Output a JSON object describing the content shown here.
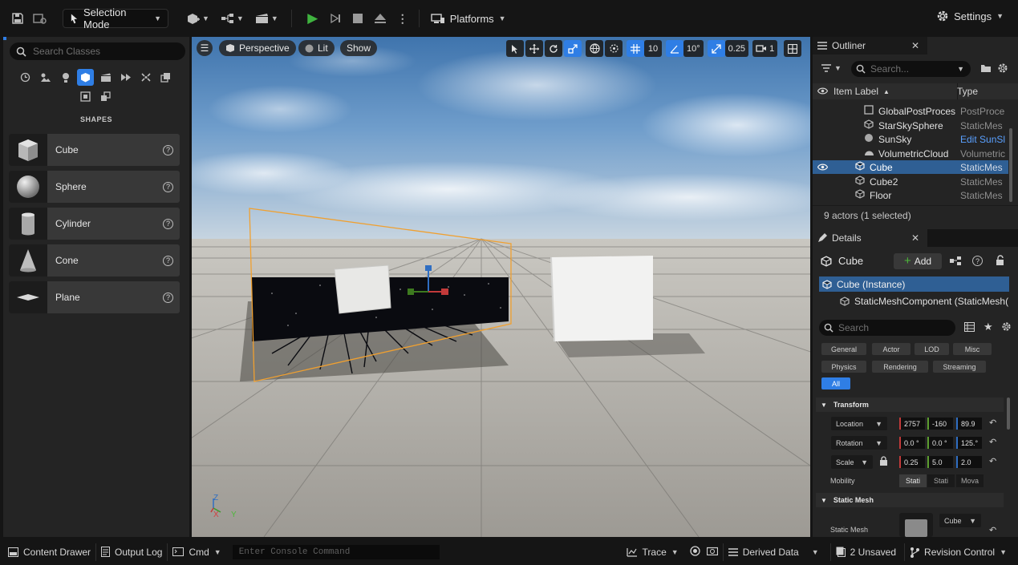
{
  "toolbar": {
    "mode_label": "Selection Mode",
    "platforms_label": "Platforms",
    "settings_label": "Settings"
  },
  "place_actors": {
    "search_placeholder": "Search Classes",
    "section_title": "SHAPES",
    "shapes": [
      {
        "label": "Cube"
      },
      {
        "label": "Sphere"
      },
      {
        "label": "Cylinder"
      },
      {
        "label": "Cone"
      },
      {
        "label": "Plane"
      }
    ]
  },
  "viewport": {
    "perspective_label": "Perspective",
    "lit_label": "Lit",
    "show_label": "Show",
    "grid_snap": "10",
    "rotation_snap": "10°",
    "scale_snap": "0.25",
    "camera_speed": "1",
    "gizmo_z": "Z",
    "gizmo_x": "X",
    "gizmo_y": "Y"
  },
  "outliner": {
    "tab_label": "Outliner",
    "search_placeholder": "Search...",
    "col_item_label": "Item Label",
    "col_type": "Type",
    "rows": [
      {
        "name": "GlobalPostProces",
        "type": "PostProce"
      },
      {
        "name": "StarSkySphere",
        "type": "StaticMes"
      },
      {
        "name": "SunSky",
        "type": "Edit SunSl"
      },
      {
        "name": "VolumetricCloud",
        "type": "Volumetric"
      },
      {
        "name": "Cube",
        "type": "StaticMes"
      },
      {
        "name": "Cube2",
        "type": "StaticMes"
      },
      {
        "name": "Floor",
        "type": "StaticMes"
      }
    ],
    "footer": "9 actors (1 selected)"
  },
  "details": {
    "tab_label": "Details",
    "actor_name": "Cube",
    "add_label": "Add",
    "instance_label": "Cube (Instance)",
    "component_label": "StaticMeshComponent (StaticMesh(",
    "search_placeholder": "Search",
    "filters": [
      "General",
      "Actor",
      "LOD",
      "Misc",
      "Physics",
      "Rendering",
      "Streaming",
      "All"
    ],
    "transform_title": "Transform",
    "location_label": "Location",
    "location": {
      "x": "2757",
      "y": "-160",
      "z": "89.9"
    },
    "rotation_label": "Rotation",
    "rotation": {
      "x": "0.0 °",
      "y": "0.0 °",
      "z": "125.°"
    },
    "scale_label": "Scale",
    "scale": {
      "x": "0.25",
      "y": "5.0",
      "z": "2.0"
    },
    "mobility_label": "Mobility",
    "mobility": [
      "Stati",
      "Stati",
      "Mova"
    ],
    "static_mesh_title": "Static Mesh",
    "static_mesh_label": "Static Mesh",
    "static_mesh_value": "Cube"
  },
  "bottombar": {
    "content_drawer": "Content Drawer",
    "output_log": "Output Log",
    "cmd": "Cmd",
    "console_placeholder": "Enter Console Command",
    "trace": "Trace",
    "derived_data": "Derived Data",
    "unsaved": "2 Unsaved",
    "revision_control": "Revision Control"
  }
}
